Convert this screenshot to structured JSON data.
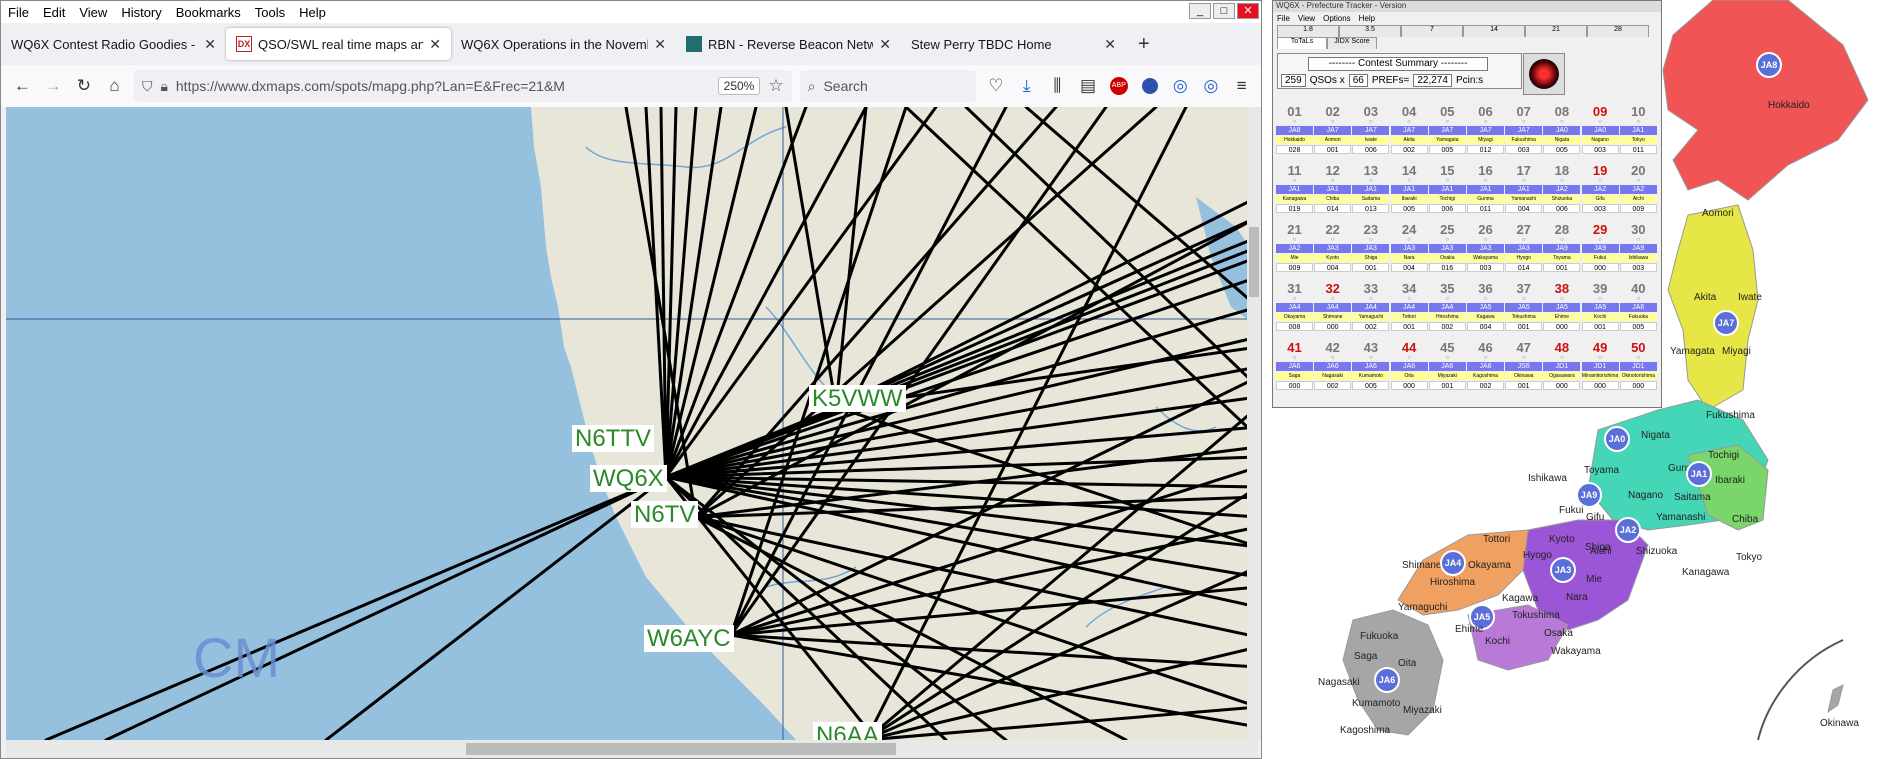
{
  "menubar": {
    "items": [
      "File",
      "Edit",
      "View",
      "History",
      "Bookmarks",
      "Tools",
      "Help"
    ]
  },
  "tabs": [
    {
      "label": "WQ6X Contest Radio Goodies - 2021",
      "active": false
    },
    {
      "label": "QSO/SWL real time maps and li",
      "active": true
    },
    {
      "label": "WQ6X Operations in the November",
      "active": false
    },
    {
      "label": "RBN - Reverse Beacon Network",
      "active": false
    },
    {
      "label": "Stew Perry TBDC Home",
      "active": false
    }
  ],
  "navbar": {
    "url": "https://www.dxmaps.com/spots/mapg.php?Lan=E&Frec=21&M",
    "zoom": "250%",
    "search_placeholder": "Search"
  },
  "map": {
    "callsigns": [
      "K5VWW",
      "N6TTV",
      "WQ6X",
      "N6TV",
      "W6AYC",
      "N6AA"
    ],
    "grid_label": "CM",
    "colors": {
      "water": "#95c0de",
      "land": "#e8e6d8",
      "paths": "#000000",
      "callsign": "#2a8a2a"
    }
  },
  "tracker": {
    "title": "WQ6X - Prefecture Tracker - Version",
    "menu": [
      "File",
      "View",
      "Options",
      "Help"
    ],
    "tabs_row1": [
      "1.8",
      "3.5",
      "7",
      "14",
      "21",
      "28"
    ],
    "tabs_row2": [
      "ToTaLs",
      "JIDX Score"
    ],
    "summary_select": "-------- Contest Summary --------",
    "qsos": "259",
    "qsos_label": "QSOs x",
    "mult": "66",
    "prefs_label": "PREFs=",
    "points": "22,274",
    "points_label": "Pcin:s",
    "cells": [
      {
        "n": "01",
        "c": "JA8",
        "p": "Hokkaido",
        "q": "028",
        "red": false
      },
      {
        "n": "02",
        "c": "JA7",
        "p": "Aomori",
        "q": "001",
        "red": false
      },
      {
        "n": "03",
        "c": "JA7",
        "p": "Iwate",
        "q": "006",
        "red": false
      },
      {
        "n": "04",
        "c": "JA7",
        "p": "Akita",
        "q": "002",
        "red": false
      },
      {
        "n": "05",
        "c": "JA7",
        "p": "Yamagata",
        "q": "005",
        "red": false
      },
      {
        "n": "06",
        "c": "JA7",
        "p": "Miyagi",
        "q": "012",
        "red": false
      },
      {
        "n": "07",
        "c": "JA7",
        "p": "Fukushima",
        "q": "003",
        "red": false
      },
      {
        "n": "08",
        "c": "JA0",
        "p": "Nigata",
        "q": "005",
        "red": false
      },
      {
        "n": "09",
        "c": "JA0",
        "p": "Nagano",
        "q": "003",
        "red": true
      },
      {
        "n": "10",
        "c": "JA1",
        "p": "Tokyo",
        "q": "011",
        "red": false
      },
      {
        "n": "11",
        "c": "JA1",
        "p": "Kanagawa",
        "q": "019",
        "red": false
      },
      {
        "n": "12",
        "c": "JA1",
        "p": "Chiba",
        "q": "014",
        "red": false
      },
      {
        "n": "13",
        "c": "JA1",
        "p": "Saitama",
        "q": "013",
        "red": false
      },
      {
        "n": "14",
        "c": "JA1",
        "p": "Ibaraki",
        "q": "005",
        "red": false
      },
      {
        "n": "15",
        "c": "JA1",
        "p": "Tochigi",
        "q": "006",
        "red": false
      },
      {
        "n": "16",
        "c": "JA1",
        "p": "Gunma",
        "q": "011",
        "red": false
      },
      {
        "n": "17",
        "c": "JA1",
        "p": "Yamanashi",
        "q": "004",
        "red": false
      },
      {
        "n": "18",
        "c": "JA2",
        "p": "Shizuoka",
        "q": "006",
        "red": false
      },
      {
        "n": "19",
        "c": "JA2",
        "p": "Gifu",
        "q": "003",
        "red": true
      },
      {
        "n": "20",
        "c": "JA2",
        "p": "Aichi",
        "q": "009",
        "red": false
      },
      {
        "n": "21",
        "c": "JA2",
        "p": "Mie",
        "q": "009",
        "red": false
      },
      {
        "n": "22",
        "c": "JA3",
        "p": "Kyoto",
        "q": "004",
        "red": false
      },
      {
        "n": "23",
        "c": "JA3",
        "p": "Shiga",
        "q": "001",
        "red": false
      },
      {
        "n": "24",
        "c": "JA3",
        "p": "Nara",
        "q": "004",
        "red": false
      },
      {
        "n": "25",
        "c": "JA3",
        "p": "Osaka",
        "q": "016",
        "red": false
      },
      {
        "n": "26",
        "c": "JA3",
        "p": "Wakayama",
        "q": "003",
        "red": false
      },
      {
        "n": "27",
        "c": "JA3",
        "p": "Hyogo",
        "q": "014",
        "red": false
      },
      {
        "n": "28",
        "c": "JA9",
        "p": "Toyama",
        "q": "001",
        "red": false
      },
      {
        "n": "29",
        "c": "JA9",
        "p": "Fukui",
        "q": "000",
        "red": true
      },
      {
        "n": "30",
        "c": "JA9",
        "p": "Ishikawa",
        "q": "003",
        "red": false
      },
      {
        "n": "31",
        "c": "JA4",
        "p": "Okayama",
        "q": "008",
        "red": false
      },
      {
        "n": "32",
        "c": "JA4",
        "p": "Shimane",
        "q": "000",
        "red": true
      },
      {
        "n": "33",
        "c": "JA4",
        "p": "Yamaguchi",
        "q": "002",
        "red": false
      },
      {
        "n": "34",
        "c": "JA4",
        "p": "Tottori",
        "q": "001",
        "red": false
      },
      {
        "n": "35",
        "c": "JA4",
        "p": "Hiroshima",
        "q": "002",
        "red": false
      },
      {
        "n": "36",
        "c": "JA5",
        "p": "Kagawa",
        "q": "004",
        "red": false
      },
      {
        "n": "37",
        "c": "JA5",
        "p": "Tokushima",
        "q": "001",
        "red": false
      },
      {
        "n": "38",
        "c": "JA5",
        "p": "Ehime",
        "q": "000",
        "red": true
      },
      {
        "n": "39",
        "c": "JA5",
        "p": "Kochi",
        "q": "001",
        "red": false
      },
      {
        "n": "40",
        "c": "JA6",
        "p": "Fukuoka",
        "q": "005",
        "red": false
      },
      {
        "n": "41",
        "c": "JA6",
        "p": "Saga",
        "q": "000",
        "red": true
      },
      {
        "n": "42",
        "c": "JA6",
        "p": "Nagasaki",
        "q": "002",
        "red": false
      },
      {
        "n": "43",
        "c": "JA6",
        "p": "Kumamoto",
        "q": "005",
        "red": false
      },
      {
        "n": "44",
        "c": "JA6",
        "p": "Oita",
        "q": "000",
        "red": true
      },
      {
        "n": "45",
        "c": "JA6",
        "p": "Miyazaki",
        "q": "001",
        "red": false
      },
      {
        "n": "46",
        "c": "JA6",
        "p": "Kagoshima",
        "q": "002",
        "red": false
      },
      {
        "n": "47",
        "c": "JS6",
        "p": "Okinawa",
        "q": "001",
        "red": false
      },
      {
        "n": "48",
        "c": "JD1",
        "p": "Ogasawara",
        "q": "000",
        "red": true
      },
      {
        "n": "49",
        "c": "JD1",
        "p": "Minamitorishima",
        "q": "000",
        "red": true
      },
      {
        "n": "50",
        "c": "JD1",
        "p": "Okinotorishima",
        "q": "000",
        "red": true
      }
    ]
  },
  "japan": {
    "prefectures": [
      "Hokkaido",
      "Aomori",
      "Akita",
      "Iwate",
      "JA7",
      "Yamagata",
      "Miyagi",
      "Fukushima",
      "Nigata",
      "JA0",
      "Tochigi",
      "Gunma",
      "Ibaraki",
      "Toyama",
      "Ishikawa",
      "JA9",
      "Nagano",
      "Saitama",
      "Fukui",
      "Gifu",
      "Yamanashi",
      "Chiba",
      "JA2",
      "Aichi",
      "Shizuoka",
      "Tokyo",
      "Kanagawa",
      "Tottori",
      "Kyoto",
      "Shiga",
      "Hyogo",
      "JA3",
      "Mie",
      "Shimane",
      "JA4",
      "Okayama",
      "Hiroshima",
      "Nara",
      "Kagawa",
      "Yamaguchi",
      "Tokushima",
      "JA5",
      "Ehime",
      "Osaka",
      "Kochi",
      "Wakayama",
      "Fukuoka",
      "Saga",
      "Oita",
      "JA6",
      "Nagasaki",
      "Kumamoto",
      "Miyazaki",
      "Kagoshima",
      "Okinawa",
      "JA8",
      "JA1"
    ]
  }
}
